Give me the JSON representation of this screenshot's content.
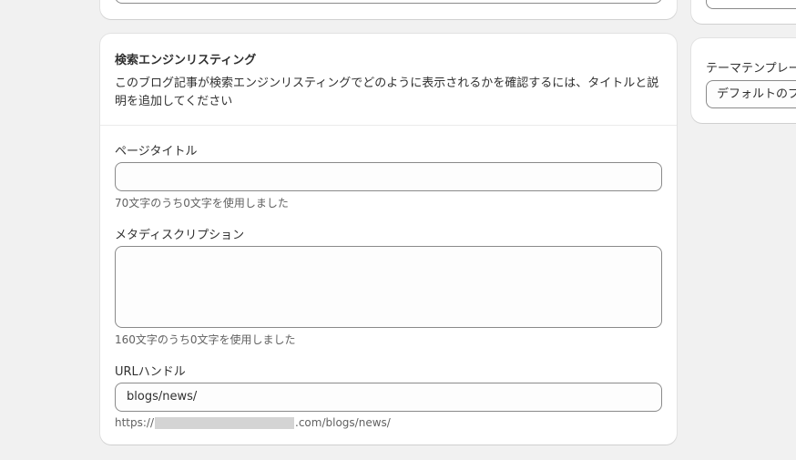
{
  "right_panel": {
    "template_label": "テーマテンプレート",
    "template_value": "デフォルトのブログ記事"
  },
  "seo": {
    "title": "検索エンジンリスティング",
    "description": "このブログ記事が検索エンジンリスティングでどのように表示されるかを確認するには、タイトルと説明を追加してください",
    "page_title_label": "ページタイトル",
    "page_title_value": "",
    "page_title_help": "70文字のうち0文字を使用しました",
    "meta_label": "メタディスクリプション",
    "meta_value": "",
    "meta_help": "160文字のうち0文字を使用しました",
    "url_label": "URLハンドル",
    "url_value": "blogs/news/",
    "url_prefix": "https://",
    "url_suffix": ".com/blogs/news/"
  },
  "colors": {
    "page_background": "#f1f1f1",
    "card_background": "#ffffff",
    "field_border": "#8a8a8a",
    "help_text": "#616161",
    "redaction": "#d4d4d4"
  }
}
